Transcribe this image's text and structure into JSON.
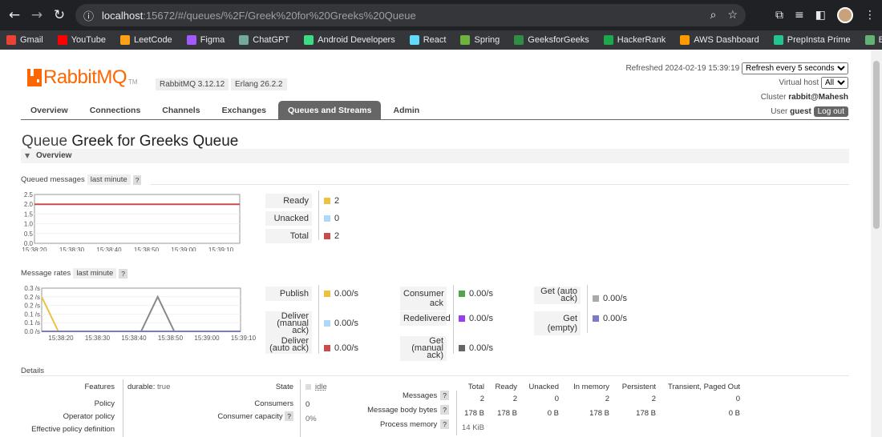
{
  "browser": {
    "url_host": "localhost",
    "url_rest": ":15672/#/queues/%2F/Greek%20for%20Greeks%20Queue",
    "bookmarks": [
      {
        "label": "Gmail",
        "color": "#ea4335"
      },
      {
        "label": "YouTube",
        "color": "#ff0000"
      },
      {
        "label": "LeetCode",
        "color": "#ffa116"
      },
      {
        "label": "Figma",
        "color": "#a259ff"
      },
      {
        "label": "ChatGPT",
        "color": "#74aa9c"
      },
      {
        "label": "Android Developers",
        "color": "#3ddc84"
      },
      {
        "label": "React",
        "color": "#61dafb"
      },
      {
        "label": "Spring",
        "color": "#6db33f"
      },
      {
        "label": "GeeksforGeeks",
        "color": "#2f8d46"
      },
      {
        "label": "HackerRank",
        "color": "#1ba94c"
      },
      {
        "label": "AWS Dashboard",
        "color": "#ff9900"
      },
      {
        "label": "PrepInsta Prime",
        "color": "#23c48e"
      },
      {
        "label": "Baeldung",
        "color": "#63b175"
      }
    ]
  },
  "header": {
    "logo_text": "RabbitMQ",
    "logo_tm": "TM",
    "rabbit_version": "RabbitMQ 3.12.12",
    "erlang_version": "Erlang 26.2.2",
    "refreshed": "Refreshed 2024-02-19 15:39:19",
    "refresh_option": "Refresh every 5 seconds",
    "virtual_host_label": "Virtual host",
    "virtual_host_value": "All",
    "cluster_label": "Cluster",
    "cluster_value": "rabbit@Mahesh",
    "user_label": "User",
    "user_value": "guest",
    "logout": "Log out"
  },
  "tabs": [
    "Overview",
    "Connections",
    "Channels",
    "Exchanges",
    "Queues and Streams",
    "Admin"
  ],
  "active_tab": "Queues and Streams",
  "queue": {
    "prefix": "Queue",
    "name": "Greek for Greeks Queue",
    "section_title": "Overview"
  },
  "queued_messages": {
    "label": "Queued messages",
    "range": "last minute",
    "help": "?",
    "legend": [
      {
        "label": "Ready",
        "value": "2",
        "color": "#edc240"
      },
      {
        "label": "Unacked",
        "value": "0",
        "color": "#afd8f8"
      },
      {
        "label": "Total",
        "value": "2",
        "color": "#cb4b4b"
      }
    ]
  },
  "message_rates": {
    "label": "Message rates",
    "range": "last minute",
    "help": "?",
    "col1": [
      {
        "label": "Publish",
        "value": "0.00/s",
        "color": "#edc240"
      },
      {
        "label": "Deliver (manual ack)",
        "value": "0.00/s",
        "color": "#afd8f8"
      },
      {
        "label": "Deliver (auto ack)",
        "value": "0.00/s",
        "color": "#cb4b4b"
      }
    ],
    "col2": [
      {
        "label": "Consumer ack",
        "value": "0.00/s",
        "color": "#4da74d"
      },
      {
        "label": "Redelivered",
        "value": "0.00/s",
        "color": "#9440ed"
      },
      {
        "label": "Get (manual ack)",
        "value": "0.00/s",
        "color": "#666666"
      }
    ],
    "col3": [
      {
        "label": "Get (auto ack)",
        "value": "0.00/s",
        "color": "#aaaaaa"
      },
      {
        "label": "Get (empty)",
        "value": "0.00/s",
        "color": "#7c79c9"
      }
    ]
  },
  "chart_data": [
    {
      "type": "line",
      "title": "Queued messages",
      "x": [
        "15:38:20",
        "15:38:30",
        "15:38:40",
        "15:38:50",
        "15:39:00",
        "15:39:10"
      ],
      "y_ticks": [
        "0.0",
        "0.5",
        "1.0",
        "1.5",
        "2.0",
        "2.5"
      ],
      "ylim": [
        0,
        2.5
      ],
      "series": [
        {
          "name": "Total",
          "color": "#cb4b4b",
          "values": [
            2,
            2,
            2,
            2,
            2,
            2
          ]
        }
      ]
    },
    {
      "type": "line",
      "title": "Message rates",
      "x": [
        "15:38:20",
        "15:38:30",
        "15:38:40",
        "15:38:50",
        "15:39:00",
        "15:39:10"
      ],
      "y_ticks": [
        "0.0 /s",
        "0.1 /s",
        "0.1 /s",
        "0.2 /s",
        "0.2 /s",
        "0.3 /s"
      ],
      "ylim": [
        0,
        0.25
      ],
      "series": [
        {
          "name": "Publish",
          "color": "#edc240",
          "values": [
            0.2,
            0,
            0,
            0,
            0,
            0,
            0,
            0,
            0,
            0,
            0,
            0,
            0
          ]
        },
        {
          "name": "Get (manual ack)",
          "color": "#888888",
          "values": [
            0,
            0,
            0,
            0,
            0,
            0,
            0,
            0.2,
            0,
            0,
            0,
            0,
            0
          ]
        },
        {
          "name": "Get (empty)",
          "color": "#7c79c9",
          "values": [
            0,
            0,
            0,
            0,
            0,
            0,
            0,
            0,
            0,
            0,
            0,
            0,
            0
          ]
        }
      ]
    }
  ],
  "details": {
    "label": "Details",
    "features_label": "Features",
    "features_key": "durable:",
    "features_val": "true",
    "policy_label": "Policy",
    "operator_policy_label": "Operator policy",
    "effective_policy_label": "Effective policy definition",
    "state_label": "State",
    "state_value": "idle",
    "consumers_label": "Consumers",
    "consumers_value": "0",
    "consumer_capacity_label": "Consumer capacity",
    "consumer_capacity_value": "0%",
    "stats_headers": [
      "Total",
      "Ready",
      "Unacked",
      "In memory",
      "Persistent",
      "Transient, Paged Out"
    ],
    "rows": [
      {
        "label": "Messages",
        "values": [
          "2",
          "2",
          "0",
          "2",
          "2",
          "0"
        ]
      },
      {
        "label": "Message body bytes",
        "values": [
          "178 B",
          "178 B",
          "0 B",
          "178 B",
          "178 B",
          "0 B"
        ]
      },
      {
        "label": "Process memory",
        "values": [
          "14 KiB"
        ]
      }
    ]
  }
}
